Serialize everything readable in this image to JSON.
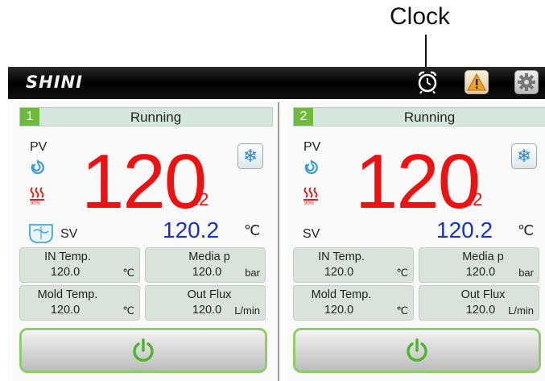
{
  "callout": {
    "label": "Clock"
  },
  "header": {
    "logo": "SHINI",
    "icons": [
      "clock-icon",
      "warning-icon",
      "gear-icon"
    ]
  },
  "colors": {
    "process_value": "#ee1111",
    "set_value": "#1830cc",
    "status_green": "#6dbb3a",
    "cell_bg": "#d9e3dc"
  },
  "units": [
    {
      "number": "1",
      "status": "Running",
      "pv_label": "PV",
      "pv_value": "120",
      "pv_decimal": ".2",
      "heat_sub": "90%",
      "sv_label": "SV",
      "sv_value": "120.2",
      "sv_unit": "℃",
      "cells": [
        {
          "title": "IN  Temp.",
          "value": "120.0",
          "unit": "℃"
        },
        {
          "title": "Media p",
          "value": "120.0",
          "unit": "bar"
        },
        {
          "title": "Mold  Temp.",
          "value": "120.0",
          "unit": "℃"
        },
        {
          "title": "Out Flux",
          "value": "120.0",
          "unit": "L/min"
        }
      ]
    },
    {
      "number": "2",
      "status": "Running",
      "pv_label": "PV",
      "pv_value": "120",
      "pv_decimal": ".2",
      "heat_sub": "90%",
      "sv_label": "SV",
      "sv_value": "120.2",
      "sv_unit": "℃",
      "cells": [
        {
          "title": "IN  Temp.",
          "value": "120.0",
          "unit": "℃"
        },
        {
          "title": "Media p",
          "value": "120.0",
          "unit": "bar"
        },
        {
          "title": "Mold  Temp.",
          "value": "120.0",
          "unit": "℃"
        },
        {
          "title": "Out Flux",
          "value": "120.0",
          "unit": "L/min"
        }
      ]
    }
  ]
}
